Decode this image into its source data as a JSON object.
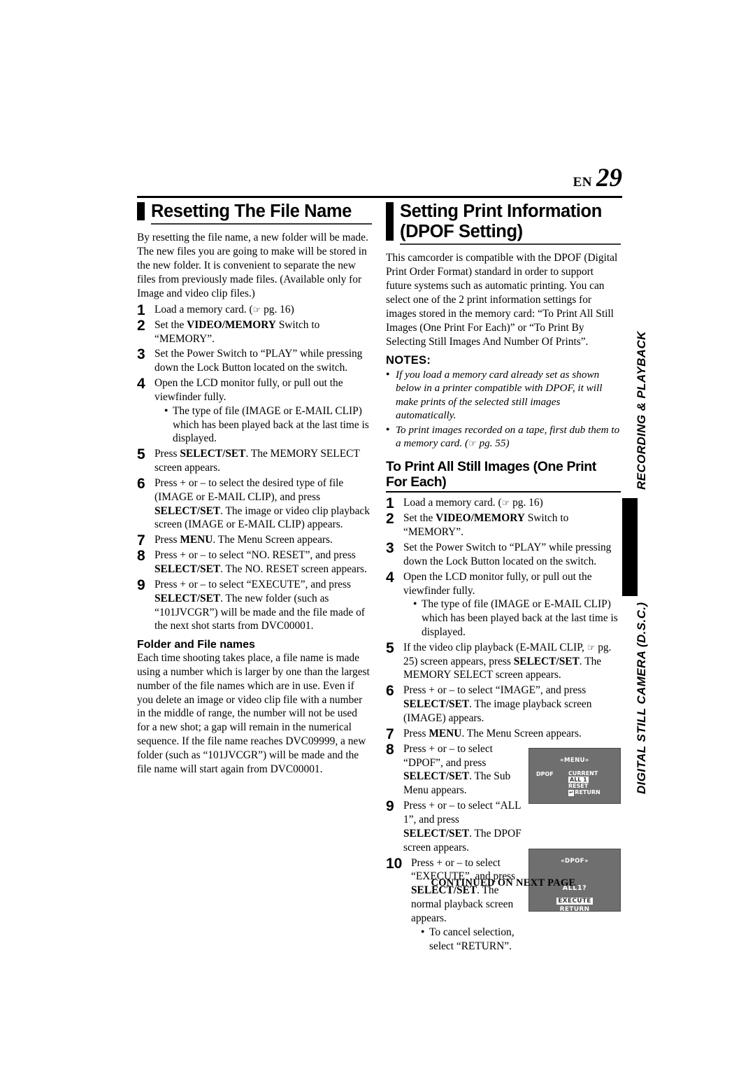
{
  "header": {
    "en_label": "EN",
    "page_number": "29"
  },
  "left_column": {
    "heading": "Resetting The File Name",
    "intro": "By resetting the file name, a new folder will be made. The new files you are going to make will be stored in the new folder. It is convenient to separate the new files from previously made files. (Available only for Image and video clip files.)",
    "steps": [
      {
        "num": "1",
        "text_html": "Load a memory card. (<span class=\"hand\">☞</span> pg. 16)"
      },
      {
        "num": "2",
        "text_html": "Set the <span class=\"b\">VIDEO/MEMORY</span> Switch to “MEMORY”."
      },
      {
        "num": "3",
        "text_html": "Set the Power Switch to “PLAY” while pressing down the Lock Button located on the switch."
      },
      {
        "num": "4",
        "text_html": "Open the LCD monitor fully, or pull out the viewfinder fully."
      },
      {
        "num": "5",
        "text_html": "Press <span class=\"b\">SELECT/SET</span>. The MEMORY SELECT screen appears."
      },
      {
        "num": "6",
        "text_html": "Press + or – to select the desired type of file (IMAGE or E-MAIL CLIP), and press <span class=\"b\">SELECT/SET</span>. The image or video clip playback screen (IMAGE or E-MAIL CLIP) appears."
      },
      {
        "num": "7",
        "text_html": "Press <span class=\"b\">MENU</span>. The Menu Screen appears."
      },
      {
        "num": "8",
        "text_html": "Press + or – to select “NO. RESET”, and press <span class=\"b\">SELECT/SET</span>. The NO. RESET screen appears."
      },
      {
        "num": "9",
        "text_html": "Press + or – to select “EXECUTE”, and press <span class=\"b\">SELECT/SET</span>. The new folder (such as “101JVCGR”) will be made and the file made of the next shot starts from DVC00001."
      }
    ],
    "step4_bullet": "The type of file (IMAGE or E-MAIL CLIP) which has been played back at the last time is displayed.",
    "subsection_heading": "Folder and File names",
    "subsection_text": "Each time shooting takes place, a file name is made using a number which is larger by one than the largest number of the file names which are in use. Even if you delete an image or video clip file with a number in the middle of range, the number will not be used for a new shot; a gap will remain in the numerical sequence. If the file name reaches DVC09999, a new folder (such as “101JVCGR”) will be made and the file name will start again from DVC00001."
  },
  "right_column": {
    "heading": "Setting Print Information (DPOF Setting)",
    "intro": "This camcorder is compatible with the DPOF (Digital Print Order Format) standard in order to support future systems such as automatic printing. You can select one of the 2 print information settings for images stored in the memory card: “To Print All Still Images (One Print For Each)” or “To Print By Selecting Still Images And Number Of Prints”.",
    "notes_title": "NOTES:",
    "notes": [
      {
        "text_html": "If you load a memory card already set as shown below in a printer compatible with DPOF, it will make prints of the selected still images automatically."
      },
      {
        "text_html": "To print images recorded on a tape, first dub them to a memory card. (<span class=\"hand\">☞</span> pg. 55)"
      }
    ],
    "subsection_heading": "To Print All Still Images (One Print For Each)",
    "steps": [
      {
        "num": "1",
        "text_html": "Load a memory card. (<span class=\"hand\">☞</span> pg. 16)"
      },
      {
        "num": "2",
        "text_html": "Set the <span class=\"b\">VIDEO/MEMORY</span> Switch to “MEMORY”."
      },
      {
        "num": "3",
        "text_html": "Set the Power Switch to “PLAY” while pressing down the Lock Button located on the switch."
      },
      {
        "num": "4",
        "text_html": "Open the LCD monitor fully, or pull out the viewfinder fully."
      },
      {
        "num": "5",
        "text_html": "If the video clip playback (E-MAIL CLIP, <span class=\"hand\">☞</span> pg. 25) screen appears, press <span class=\"b\">SELECT/SET</span>. The MEMORY SELECT screen appears."
      },
      {
        "num": "6",
        "text_html": "Press + or – to select “IMAGE”, and press <span class=\"b\">SELECT/SET</span>. The image playback screen (IMAGE) appears."
      },
      {
        "num": "7",
        "text_html": "Press <span class=\"b\">MENU</span>. The Menu Screen appears."
      },
      {
        "num": "8",
        "text_html": "Press + or – to select “DPOF”, and press <span class=\"b\">SELECT/SET</span>. The Sub Menu appears."
      },
      {
        "num": "9",
        "text_html": "Press + or – to select “ALL 1”, and press <span class=\"b\">SELECT/SET</span>. The DPOF screen appears."
      },
      {
        "num": "10",
        "text_html": "Press + or – to select “EXECUTE”, and press <span class=\"b\">SELECT/SET</span>. The normal playback screen appears."
      }
    ],
    "step4_bullet": "The type of file (IMAGE or E-MAIL CLIP) which has been played back at the last time is displayed.",
    "step10_bullet": "To cancel selection, select “RETURN”."
  },
  "lcd_menu_screen": {
    "title": "«MENU»",
    "left_label": "DPOF",
    "items": [
      "CURRENT",
      "ALL 1",
      "RESET",
      "RETURN"
    ],
    "highlighted": "ALL 1",
    "return_key_glyph": "↵"
  },
  "lcd_dpof_screen": {
    "title": "«DPOF»",
    "question": "ALL1?",
    "execute_label": "EXECUTE",
    "return_label": "RETURN",
    "highlighted": "EXECUTE"
  },
  "side_tabs": {
    "upper": "RECORDING & PLAYBACK",
    "lower": "DIGITAL STILL CAMERA (D.S.C.)"
  },
  "footer": {
    "continued": "CONTINUED ON NEXT PAGE"
  }
}
